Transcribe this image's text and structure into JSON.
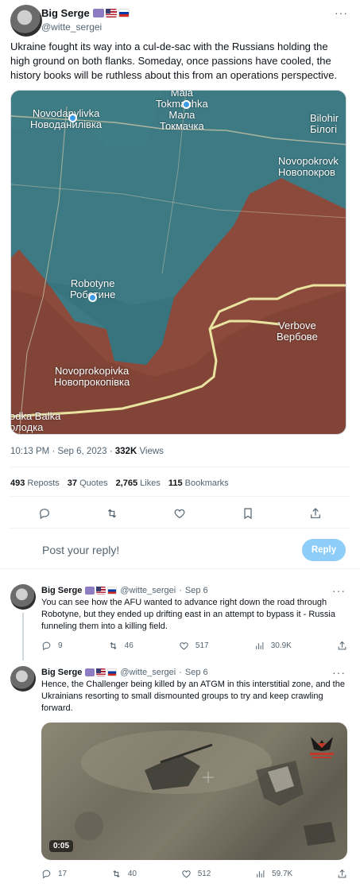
{
  "main_tweet": {
    "author_name": "Big Serge",
    "handle": "@witte_sergei",
    "text": "Ukraine fought its way into a cul-de-sac with the Russians holding the high ground on both flanks. Someday, once passions have cooled, the history books will be ruthless about this from an operations perspective.",
    "map_labels": {
      "novodanylivka_lat": "Novodanylivka",
      "novodanylivka_cyr": "Новоданилівка",
      "mala_lat": "Mala",
      "tokmachka_lat": "Tokmachka",
      "mala_cyr": "Мала",
      "tokmachka_cyr": "Токмачка",
      "bilohirya_lat": "Bilohir",
      "bilohirya_cyr": "Білогі",
      "novopokrovka_lat": "Novopokrovk",
      "novopokrovka_cyr": "Новопокров",
      "robotyne_lat": "Robotyne",
      "robotyne_cyr": "Роботине",
      "verbove_lat": "Verbove",
      "verbove_cyr": "Вербове",
      "novoprokopivka_lat": "Novoprokopivka",
      "novoprokopivka_cyr": "Новопрокопівка",
      "solodka_lat": "odka Balka",
      "solodka_cyr": "олодка"
    },
    "time": "10:13 PM",
    "date": "Sep 6, 2023",
    "views_value": "332K",
    "views_label": "Views",
    "reposts_value": "493",
    "reposts_label": "Reposts",
    "quotes_value": "37",
    "quotes_label": "Quotes",
    "likes_value": "2,765",
    "likes_label": "Likes",
    "bookmarks_value": "115",
    "bookmarks_label": "Bookmarks"
  },
  "reply_box": {
    "placeholder": "Post your reply!",
    "button_label": "Reply"
  },
  "replies": [
    {
      "author_name": "Big Serge",
      "handle": "@witte_sergei",
      "date": "Sep 6",
      "text": "You can see how the AFU wanted to advance right down the road through Robotyne, but they ended up drifting east in an attempt to bypass it - Russia funneling them into a killing field.",
      "replies": "9",
      "reposts": "46",
      "likes": "517",
      "views": "30.9K"
    },
    {
      "author_name": "Big Serge",
      "handle": "@witte_sergei",
      "date": "Sep 6",
      "text": "Hence, the Challenger being killed by an ATGM in this interstitial zone, and the Ukrainians resorting to small dismounted groups to try and keep crawling forward.",
      "video_duration": "0:05",
      "replies": "17",
      "reposts": "40",
      "likes": "512",
      "views": "59.7K"
    }
  ],
  "separator": "·",
  "icons": {
    "reply": "reply-icon",
    "repost": "repost-icon",
    "like": "heart-icon",
    "bookmark": "bookmark-icon",
    "share": "share-icon",
    "views": "views-icon",
    "more": "more-icon"
  },
  "colors": {
    "accent": "#1d9bf0",
    "reply_button": "#8ecdf8",
    "secondary_text": "#536471",
    "map_ukraine_zone": "#3d7a84",
    "map_russia_zone": "#8b4a3c",
    "frontline": "#e9e4a0"
  }
}
